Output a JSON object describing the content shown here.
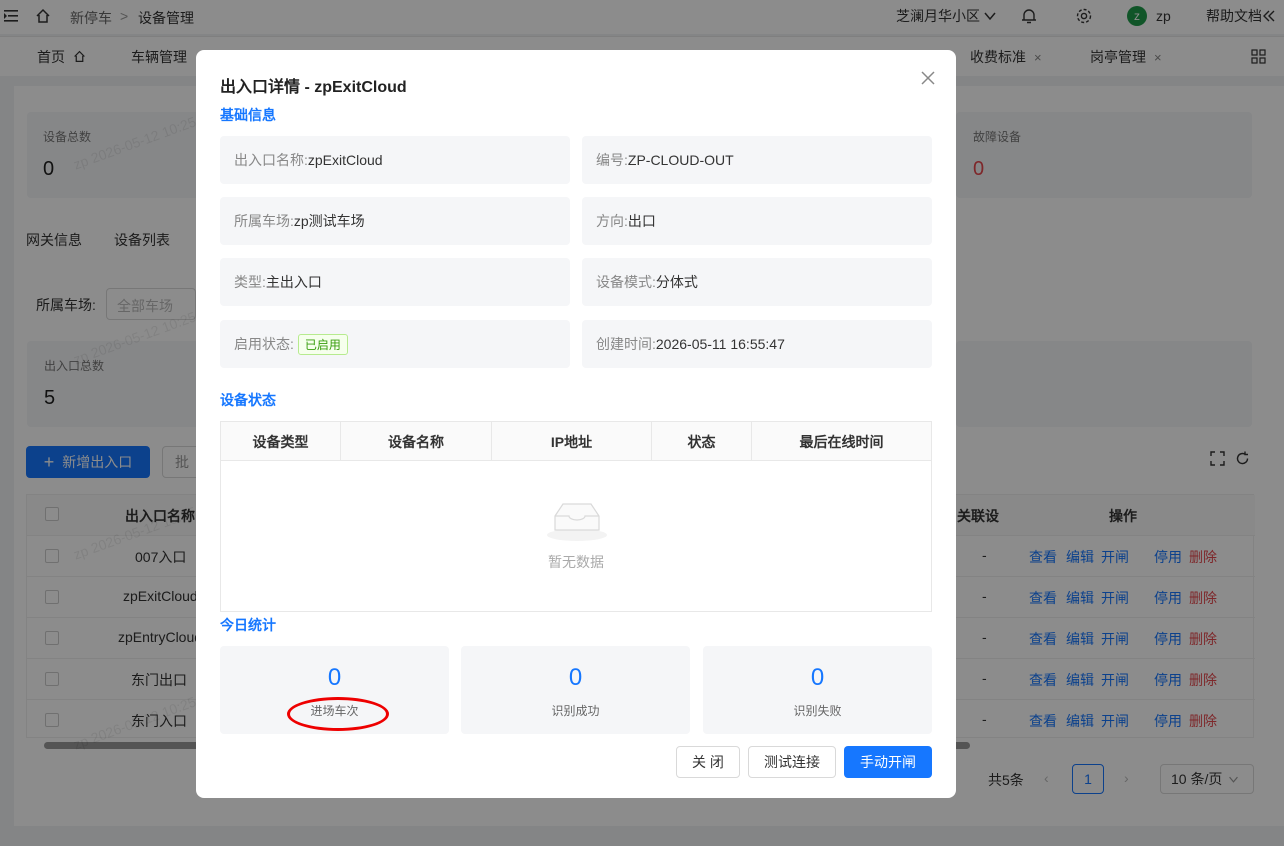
{
  "topbar": {
    "breadcrumb": [
      "新停车",
      ">",
      "设备管理"
    ],
    "community": "芝澜月华小区",
    "user": "zp",
    "user_initial": "z",
    "help": "帮助文档"
  },
  "tabs": [
    {
      "label": "首页"
    },
    {
      "label": "车辆管理"
    },
    {
      "label": "收费标准",
      "close": "×"
    },
    {
      "label": "岗亭管理",
      "close": "×"
    }
  ],
  "background": {
    "stat_cards": [
      {
        "label": "设备总数",
        "value": "0"
      },
      {
        "label": "故障设备",
        "value": "0"
      }
    ],
    "subtabs": [
      "网关信息",
      "设备列表"
    ],
    "filter_label": "所属车场:",
    "filter_placeholder": "全部车场",
    "entry_total_label": "出入口总数",
    "entry_total_value": "5",
    "add_button": "新增出入口",
    "batch_button": "批",
    "table_headers": {
      "name": "出入口名称",
      "related": "关联设",
      "ops": "操作"
    },
    "rows": [
      {
        "name": "007入口",
        "related": "-"
      },
      {
        "name": "zpExitCloud",
        "related": "-"
      },
      {
        "name": "zpEntryCloud",
        "related": "-"
      },
      {
        "name": "东门出口",
        "related": "-"
      },
      {
        "name": "东门入口",
        "related": "-"
      }
    ],
    "ops": [
      "查看",
      "编辑",
      "开闸",
      "停用",
      "删除"
    ],
    "pager": {
      "total": "共5条",
      "page": "1",
      "size": "10 条/页"
    },
    "watermark": "zp 2026-05-12 10:25"
  },
  "modal": {
    "title": "出入口详情 - zpExitCloud",
    "section_basic": "基础信息",
    "fields": {
      "name_k": "出入口名称:",
      "name_v": "zpExitCloud",
      "code_k": "编号:",
      "code_v": "ZP-CLOUD-OUT",
      "park_k": "所属车场:",
      "park_v": "zp测试车场",
      "dir_k": "方向:",
      "dir_v": "出口",
      "type_k": "类型:",
      "type_v": "主出入口",
      "mode_k": "设备模式:",
      "mode_v": "分体式",
      "status_k": "启用状态:",
      "status_v": "已启用",
      "created_k": "创建时间:",
      "created_v": "2026-05-11 16:55:47"
    },
    "section_device": "设备状态",
    "device_headers": [
      "设备类型",
      "设备名称",
      "IP地址",
      "状态",
      "最后在线时间"
    ],
    "empty_text": "暂无数据",
    "section_today": "今日统计",
    "stats": [
      {
        "value": "0",
        "label": "进场车次"
      },
      {
        "value": "0",
        "label": "识别成功"
      },
      {
        "value": "0",
        "label": "识别失败"
      }
    ],
    "buttons": {
      "close": "关 闭",
      "test": "测试连接",
      "open": "手动开闸"
    }
  }
}
